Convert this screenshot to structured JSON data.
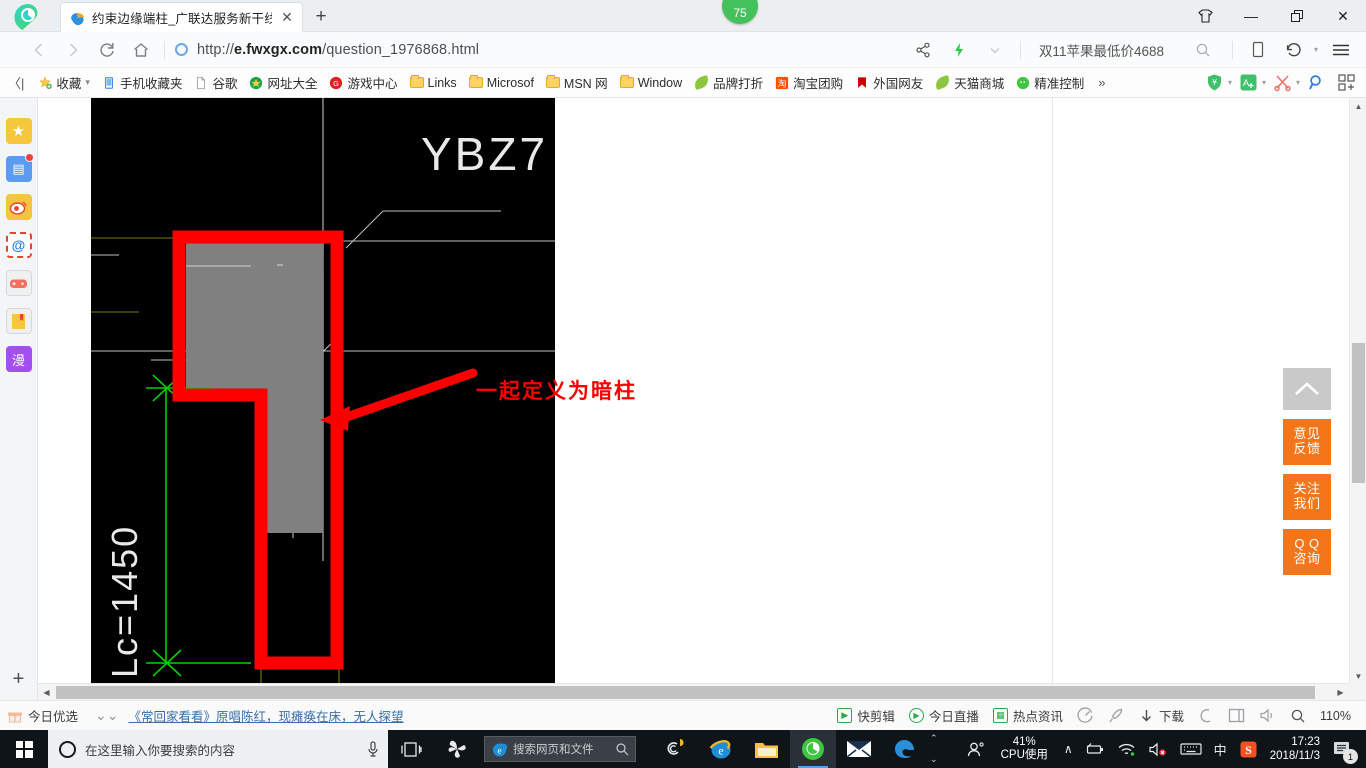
{
  "window": {
    "tab": {
      "title": "约束边缘端柱_广联达服务新干线",
      "favicon": "browser-favicon",
      "close_label": "✕"
    },
    "new_tab_label": "+",
    "download_badge": "75",
    "controls": {
      "theme": "shirt-icon",
      "minimize": "—",
      "maximize": "❐",
      "close": "✕"
    }
  },
  "navbar": {
    "back": "‹",
    "forward": "›",
    "reload": "⟳",
    "home": "⌂",
    "url_prefix": "http://",
    "url_domain": "e.fwxgx.com",
    "url_path": "/question_1976868.html",
    "share_icon": "share-icon",
    "lightning_icon": "lightning-icon",
    "caret_icon": "chevron-down-icon",
    "search_keyword": "双11苹果最低价4688",
    "search_icon": "search-icon",
    "phone_icon": "mobile-view-icon",
    "history_icon": "history-back-icon",
    "menu_icon": "hamburger-menu-icon"
  },
  "bookmarks": {
    "collapse_label": "〈|",
    "items": [
      {
        "label": "收藏",
        "icon": "star-folder-icon",
        "caret": true
      },
      {
        "label": "手机收藏夹",
        "icon": "phone-icon"
      },
      {
        "label": "谷歌",
        "icon": "page-icon"
      },
      {
        "label": "网址大全",
        "icon": "hao123-icon"
      },
      {
        "label": "游戏中心",
        "icon": "game-center-icon"
      },
      {
        "label": "Links",
        "icon": "folder-icon"
      },
      {
        "label": "Microsof",
        "icon": "folder-icon"
      },
      {
        "label": "MSN 网",
        "icon": "folder-icon"
      },
      {
        "label": "Window",
        "icon": "folder-icon"
      },
      {
        "label": "品牌打折",
        "icon": "leaf-icon"
      },
      {
        "label": "淘宝团购",
        "icon": "taobao-icon"
      },
      {
        "label": "外国网友",
        "icon": "red-flag-icon"
      },
      {
        "label": "天猫商城",
        "icon": "leaf-icon"
      },
      {
        "label": "精准控制",
        "icon": "wechat-icon"
      }
    ],
    "overflow_label": "»",
    "tools": [
      {
        "name": "shield-icon",
        "glyph": "¥"
      },
      {
        "name": "translate-icon",
        "glyph": "A"
      },
      {
        "name": "scissors-icon",
        "glyph": "✂"
      },
      {
        "name": "magnifier-icon",
        "glyph": "⌕"
      },
      {
        "name": "extensions-grid-icon",
        "glyph": "▦"
      }
    ]
  },
  "sidebar": {
    "items": [
      {
        "name": "sidebar-item-favorites",
        "icon": "star-icon",
        "glyph": "★",
        "bg": "#f6c63c",
        "badge": false
      },
      {
        "name": "sidebar-item-news",
        "icon": "news-icon",
        "glyph": "▤",
        "bg": "#5b9bf0",
        "badge": true
      },
      {
        "name": "sidebar-item-weibo",
        "icon": "weibo-icon",
        "glyph": "◉",
        "bg": "#f5c542",
        "badge": false
      },
      {
        "name": "sidebar-item-mail",
        "icon": "mail-at-icon",
        "glyph": "@",
        "bg": "#ffffff",
        "badge": false
      },
      {
        "name": "sidebar-item-games",
        "icon": "gamepad-icon",
        "glyph": "⌘",
        "bg": "#f0f0f0",
        "badge": false
      },
      {
        "name": "sidebar-item-novel",
        "icon": "book-icon",
        "glyph": "▯",
        "bg": "#f0f0f0",
        "badge": false
      },
      {
        "name": "sidebar-item-comics",
        "icon": "comics-icon",
        "glyph": "漫",
        "bg": "#a24ff0",
        "badge": false
      }
    ],
    "add_label": "+"
  },
  "page": {
    "cad_drawing": {
      "label_ybz7": "YBZ7",
      "dimension_label": "Lc=1450",
      "annotation_text": "一起定义为暗柱",
      "annotation_color": "#fb0000",
      "highlight_color": "#ff0000",
      "background": "#000000"
    },
    "float_panel": {
      "back_to_top": {
        "name": "back-to-top-button",
        "glyph": "︿"
      },
      "buttons": [
        {
          "name": "feedback-button",
          "line1": "意见",
          "line2": "反馈"
        },
        {
          "name": "follow-us-button",
          "line1": "关注",
          "line2": "我们"
        },
        {
          "name": "qq-consult-button",
          "line1": "Q Q",
          "line2": "咨询"
        }
      ]
    }
  },
  "statusbar": {
    "today_picks": {
      "label": "今日优选",
      "icon": "gift-icon"
    },
    "expand_icon": "double-chevron-down-icon",
    "news": "《常回家看看》原唱陈红，现瘫痪在床，无人探望",
    "right_items": [
      {
        "label": "快剪辑",
        "icon": "video-edit-icon"
      },
      {
        "label": "今日直播",
        "icon": "live-play-icon"
      },
      {
        "label": "热点资讯",
        "icon": "hot-news-icon"
      },
      {
        "label": "",
        "icon": "speed-icon"
      },
      {
        "label": "",
        "icon": "rocket-icon"
      },
      {
        "label": "下载",
        "icon": "download-icon"
      },
      {
        "label": "",
        "icon": "shield-safe-icon"
      },
      {
        "label": "",
        "icon": "split-window-icon"
      },
      {
        "label": "",
        "icon": "volume-icon"
      },
      {
        "label": "",
        "icon": "search-icon"
      }
    ],
    "zoom_level": "110%"
  },
  "taskbar": {
    "start_label": "start-button",
    "search_placeholder": "在这里输入你要搜索的内容",
    "mic_icon": "microphone-icon",
    "taskview_icon": "task-view-icon",
    "apps": [
      {
        "name": "taskbar-app-pinwheel",
        "icon": "pinwheel-icon",
        "active": false
      },
      {
        "name": "taskbar-app-ie-search",
        "icon": "ie-icon",
        "active": false
      },
      {
        "name": "taskbar-app-cortana",
        "icon": "spiral-icon",
        "active": false
      },
      {
        "name": "taskbar-app-ie",
        "icon": "ie-icon",
        "active": false
      },
      {
        "name": "taskbar-app-explorer",
        "icon": "folder-icon",
        "active": false
      },
      {
        "name": "taskbar-app-360browser",
        "icon": "green-e-icon",
        "active": true
      },
      {
        "name": "taskbar-app-mail",
        "icon": "envelope-icon",
        "active": false
      },
      {
        "name": "taskbar-app-edge",
        "icon": "edge-icon",
        "active": false
      }
    ],
    "ie_search_placeholder": "搜索网页和文件",
    "tray": {
      "people_icon": "people-icon",
      "cpu_percent": "41%",
      "cpu_label": "CPU使用",
      "chevron": "∧",
      "battery_icon": "battery-icon",
      "wifi_icon": "wifi-icon",
      "volume_icon": "volume-muted-icon",
      "keyboard_icon": "keyboard-icon",
      "ime_label": "中",
      "sogou_icon": "sogou-icon",
      "time": "17:23",
      "date": "2018/11/3",
      "notification_count": "1",
      "notification_icon": "notification-icon"
    }
  }
}
